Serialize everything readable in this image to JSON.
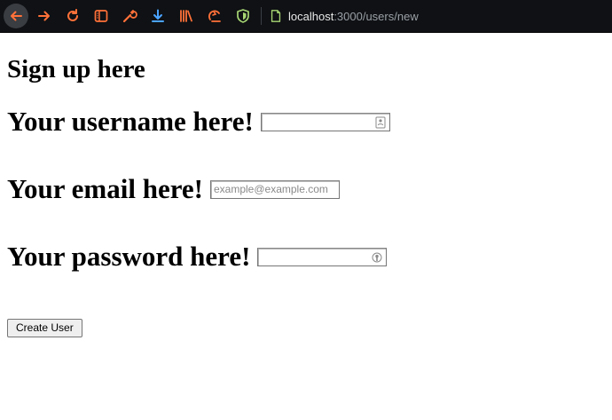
{
  "browser": {
    "url_host": "localhost",
    "url_path": ":3000/users/new",
    "icons": [
      "back-icon",
      "forward-icon",
      "reload-icon",
      "reader-view-icon",
      "tools-icon",
      "downloads-icon",
      "library-icon",
      "sync-icon",
      "shield-icon",
      "page-icon"
    ],
    "accent": "#ff7139"
  },
  "page": {
    "title": "Sign up here",
    "username_label": "Your username here!",
    "email_label": "Your email here!",
    "email_placeholder": "example@example.com",
    "password_label": "Your password here!",
    "submit_label": "Create User"
  }
}
